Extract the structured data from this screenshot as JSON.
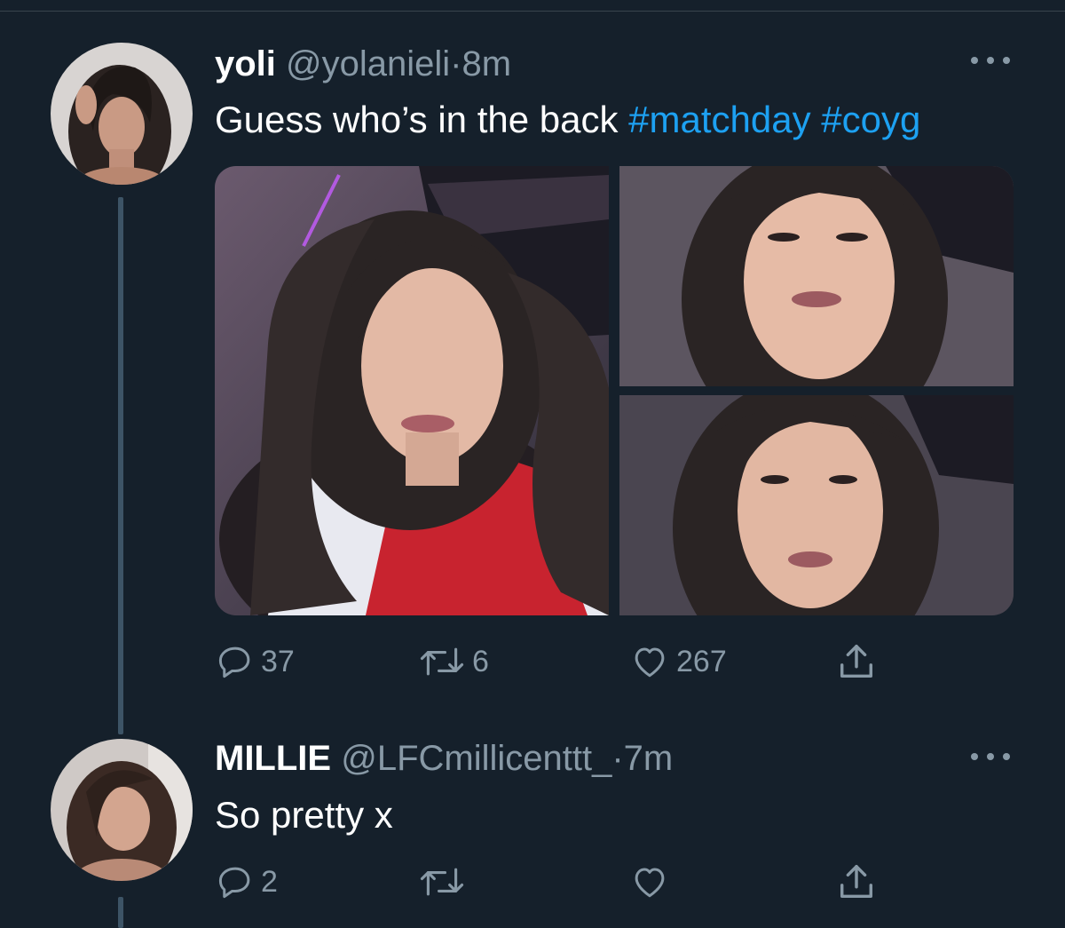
{
  "tweets": [
    {
      "name": "yoli",
      "handle": "@yolanieli",
      "separator": "·",
      "time": "8m",
      "text": "Guess who’s in the back ",
      "hashtags": [
        "#matchday",
        "#coyg"
      ],
      "images": [
        "selfie-photo-1",
        "selfie-photo-2",
        "selfie-photo-3"
      ],
      "actions": {
        "reply_count": "37",
        "retweet_count": "6",
        "like_count": "267"
      }
    },
    {
      "name": "MILLIE",
      "handle": "@LFCmillicenttt_",
      "separator": "·",
      "time": "7m",
      "text": "So pretty x",
      "actions": {
        "reply_count": "2",
        "retweet_count": "",
        "like_count": ""
      }
    }
  ],
  "icons": [
    "more-icon",
    "reply-icon",
    "retweet-icon",
    "like-icon",
    "share-icon"
  ],
  "colors": {
    "background": "#15202b",
    "secondary_text": "#8899a6",
    "link": "#1da1f2",
    "thread_line": "#3d5466"
  }
}
